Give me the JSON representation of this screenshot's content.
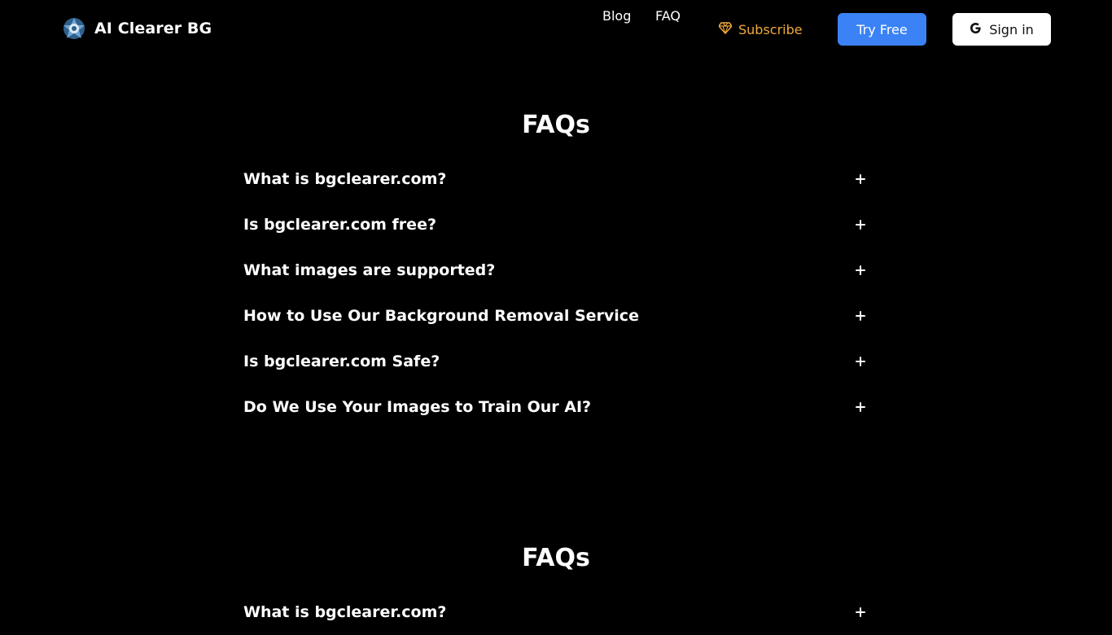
{
  "header": {
    "brand_name": "AI Clearer BG",
    "nav": {
      "blog": "Blog",
      "faq": "FAQ",
      "subscribe": "Subscribe",
      "try_free": "Try Free",
      "sign_in": "Sign in"
    }
  },
  "colors": {
    "background": "#000000",
    "accent_blue": "#3b82f6",
    "subscribe_gold": "#f0a93a"
  },
  "icons": {
    "logo": "aperture-logo-icon",
    "subscribe": "diamond-icon",
    "sign_in": "google-icon",
    "expand": "plus-icon"
  },
  "faq_sections": [
    {
      "title": "FAQs",
      "items": [
        "What is bgclearer.com?",
        "Is bgclearer.com free?",
        "What images are supported?",
        "How to Use Our Background Removal Service",
        "Is bgclearer.com Safe?",
        "Do We Use Your Images to Train Our AI?"
      ]
    },
    {
      "title": "FAQs",
      "items": [
        "What is bgclearer.com?"
      ]
    }
  ]
}
